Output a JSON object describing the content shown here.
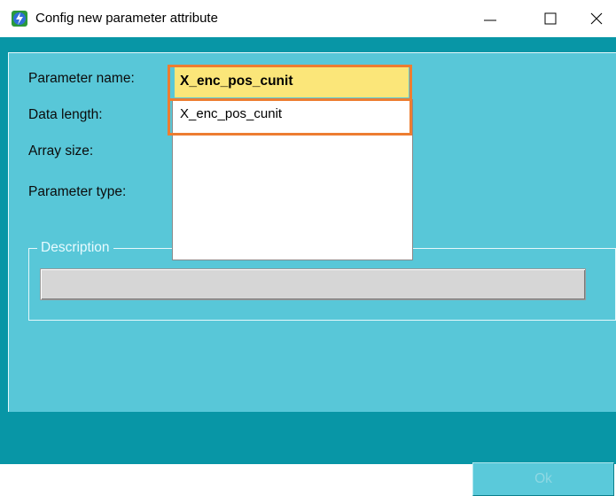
{
  "window": {
    "title": "Config new parameter attribute",
    "app_icon": "lightning-app-icon",
    "controls": {
      "minimize": "minimize-icon",
      "maximize": "maximize-icon",
      "close": "close-icon"
    }
  },
  "form": {
    "parameter_name_label": "Parameter name:",
    "parameter_name_value": "X_enc_pos_cunit",
    "data_length_label": "Data length:",
    "array_size_label": "Array size:",
    "parameter_type_label": "Parameter type:",
    "description_group_label": "Description",
    "description_value": ""
  },
  "dropdown": {
    "options": [
      "X_enc_pos_cunit"
    ]
  },
  "buttons": {
    "ok": "Ok"
  },
  "colors": {
    "client_background": "#0896a6",
    "panel_background": "#58c7d8",
    "selected_input_background": "#fbe679",
    "highlight_frame": "#ed7d31"
  }
}
